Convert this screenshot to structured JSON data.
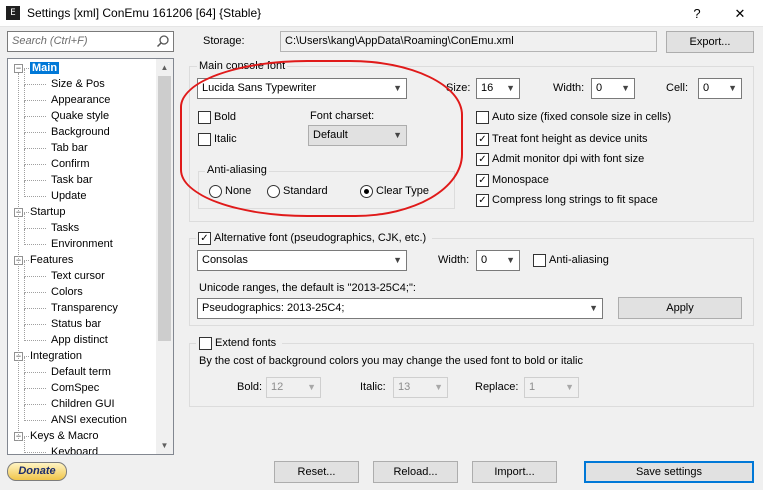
{
  "window": {
    "title": "Settings [xml] ConEmu 161206 [64] {Stable}",
    "icon_text": "E",
    "help_label": "?",
    "close_label": "✕"
  },
  "search": {
    "placeholder": "Search (Ctrl+F)"
  },
  "tree": {
    "items": [
      {
        "label": "Main",
        "level": 0,
        "expanded": true,
        "selected": true
      },
      {
        "label": "Size & Pos",
        "level": 1
      },
      {
        "label": "Appearance",
        "level": 1
      },
      {
        "label": "Quake style",
        "level": 1
      },
      {
        "label": "Background",
        "level": 1
      },
      {
        "label": "Tab bar",
        "level": 1
      },
      {
        "label": "Confirm",
        "level": 1
      },
      {
        "label": "Task bar",
        "level": 1
      },
      {
        "label": "Update",
        "level": 1
      },
      {
        "label": "Startup",
        "level": 0,
        "expanded": true
      },
      {
        "label": "Tasks",
        "level": 1
      },
      {
        "label": "Environment",
        "level": 1
      },
      {
        "label": "Features",
        "level": 0,
        "expanded": true
      },
      {
        "label": "Text cursor",
        "level": 1
      },
      {
        "label": "Colors",
        "level": 1
      },
      {
        "label": "Transparency",
        "level": 1
      },
      {
        "label": "Status bar",
        "level": 1
      },
      {
        "label": "App distinct",
        "level": 1
      },
      {
        "label": "Integration",
        "level": 0,
        "expanded": true
      },
      {
        "label": "Default term",
        "level": 1
      },
      {
        "label": "ComSpec",
        "level": 1
      },
      {
        "label": "Children GUI",
        "level": 1
      },
      {
        "label": "ANSI execution",
        "level": 1
      },
      {
        "label": "Keys & Macro",
        "level": 0,
        "expanded": true
      },
      {
        "label": "Keyboard",
        "level": 1
      }
    ]
  },
  "storage": {
    "label": "Storage:",
    "path": "C:\\Users\\kang\\AppData\\Roaming\\ConEmu.xml",
    "export_label": "Export..."
  },
  "main_font": {
    "group_label": "Main console font",
    "font_name": "Lucida Sans Typewriter",
    "size_label": "Size:",
    "size_value": "16",
    "width_label": "Width:",
    "width_value": "0",
    "cell_label": "Cell:",
    "cell_value": "0",
    "bold_label": "Bold",
    "bold_checked": false,
    "italic_label": "Italic",
    "italic_checked": false,
    "charset_label": "Font charset:",
    "charset_value": "Default",
    "antialias_label": "Anti-aliasing",
    "aa_none": "None",
    "aa_standard": "Standard",
    "aa_cleartype": "Clear Type",
    "aa_selected": "Clear Type"
  },
  "options": {
    "auto_size": {
      "label": "Auto size (fixed console size in cells)",
      "checked": false
    },
    "treat_height": {
      "label": "Treat font height as device units",
      "checked": true
    },
    "admit_dpi": {
      "label": "Admit monitor dpi with font size",
      "checked": true
    },
    "monospace": {
      "label": "Monospace",
      "checked": true
    },
    "compress": {
      "label": "Compress long strings to fit space",
      "checked": true
    }
  },
  "alt_font": {
    "enabled_label": "Alternative font (pseudographics, CJK, etc.)",
    "enabled_checked": true,
    "font_name": "Consolas",
    "width_label": "Width:",
    "width_value": "0",
    "antialias_label": "Anti-aliasing",
    "antialias_checked": false,
    "unicode_label": "Unicode ranges, the default is \"2013-25C4;\":",
    "unicode_value": "Pseudographics: 2013-25C4;",
    "apply_label": "Apply"
  },
  "extend_fonts": {
    "label": "Extend fonts",
    "checked": false,
    "description": "By the cost of background colors you may change the used font to bold or italic",
    "bold_label": "Bold:",
    "bold_value": "12",
    "italic_label": "Italic:",
    "italic_value": "13",
    "replace_label": "Replace:",
    "replace_value": "1"
  },
  "footer": {
    "donate_label": "Donate",
    "reset_label": "Reset...",
    "reload_label": "Reload...",
    "import_label": "Import...",
    "save_label": "Save settings"
  },
  "colors": {
    "selection": "#0078d7",
    "highlight_circle": "#e01a1a"
  }
}
